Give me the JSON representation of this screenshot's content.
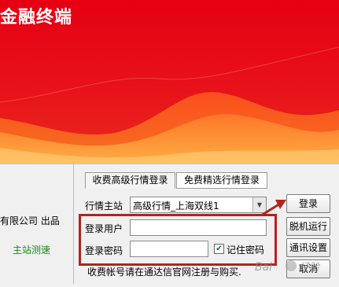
{
  "window": {
    "title": "金融终端"
  },
  "left_panel": {
    "company_text": "有限公司 出品",
    "test_link": "主站测速",
    "test_link_color": "#1b8a1b"
  },
  "tabs": [
    {
      "label": "收费高级行情登录",
      "active": true
    },
    {
      "label": "免费精选行情登录",
      "active": false
    }
  ],
  "form": {
    "server_label": "行情主站",
    "server_value": "高级行情_上海双线1",
    "user_label": "登录用户",
    "user_value": "",
    "password_label": "登录密码",
    "password_value": "",
    "remember_label": "记住密码",
    "remember_checked": true,
    "note": "收费帐号请在通达信官网注册与购买."
  },
  "buttons": {
    "login": "登录",
    "offline": "脱机运行",
    "comm_settings": "通讯设置",
    "cancel": "取消"
  },
  "colors": {
    "banner_red": "#e60012",
    "annotation_red": "#b0241e"
  },
  "watermark": {
    "text": "Bai 经验"
  }
}
